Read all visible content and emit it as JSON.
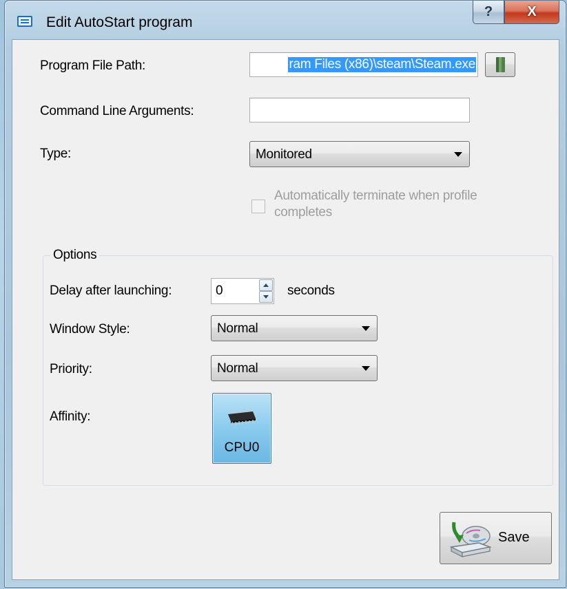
{
  "window": {
    "title": "Edit AutoStart program",
    "help_glyph": "?",
    "close_glyph": "X"
  },
  "fields": {
    "program_path_label": "Program File Path:",
    "program_path_value": "ram Files (x86)\\steam\\Steam.exe",
    "command_args_label": "Command Line Arguments:",
    "command_args_value": "",
    "type_label": "Type:",
    "type_value": "Monitored",
    "auto_terminate_label": "Automatically terminate when profile completes",
    "auto_terminate_checked": false
  },
  "options": {
    "group_title": "Options",
    "delay_label": "Delay after launching:",
    "delay_value": "0",
    "delay_unit": "seconds",
    "window_style_label": "Window Style:",
    "window_style_value": "Normal",
    "priority_label": "Priority:",
    "priority_value": "Normal",
    "affinity_label": "Affinity:",
    "cpu_label": "CPU0"
  },
  "actions": {
    "save_label": "Save"
  },
  "icons": {
    "title": "app-window-icon",
    "browse": "book-icon",
    "cpu": "chip-icon",
    "save": "save-disk-icon"
  },
  "colors": {
    "selection": "#3399ff",
    "close_button": "#c4391c",
    "cpu_tile": "#8bcbee"
  }
}
